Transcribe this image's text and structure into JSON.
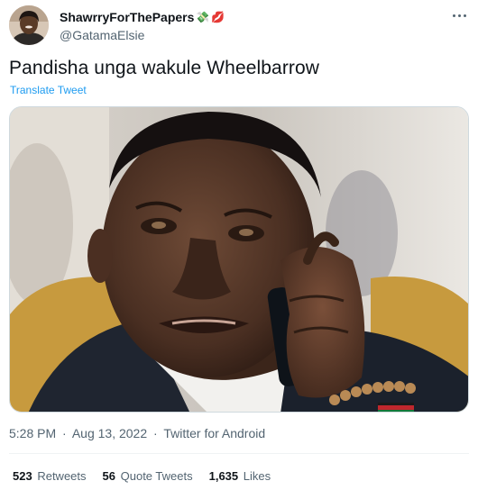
{
  "author": {
    "display_name": "ShawrryForThePapers",
    "emojis": [
      "💸",
      "💋"
    ],
    "handle": "@GatamaElsie",
    "avatar_icon": "profile-photo"
  },
  "tweet": {
    "text": "Pandisha unga wakule Wheelbarrow",
    "translate_label": "Translate Tweet",
    "media_icon": "photo-man-on-phone"
  },
  "meta": {
    "time": "5:28 PM",
    "separator": "·",
    "date": "Aug 13, 2022",
    "source": "Twitter for Android"
  },
  "stats": {
    "retweets": {
      "count": "523",
      "label": "Retweets"
    },
    "quotes": {
      "count": "56",
      "label": "Quote Tweets"
    },
    "likes": {
      "count": "1,635",
      "label": "Likes"
    }
  },
  "colors": {
    "accent": "#1d9bf0",
    "text": "#0f1419",
    "secondary": "#536471"
  }
}
